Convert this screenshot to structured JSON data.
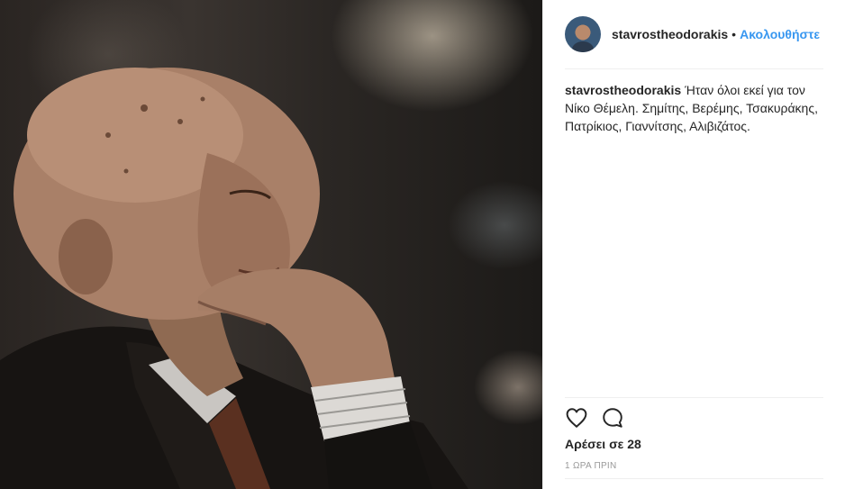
{
  "post": {
    "username": "stavrostheodorakis",
    "separator": "•",
    "follow_label": "Ακολουθήστε",
    "caption_user": "stavrostheodorakis",
    "caption_text": "Ήταν όλοι εκεί για τον Νίκο Θέμελη. Σημίτης, Βερέμης, Τσακυράκης, Πατρίκιος, Γιαννίτσης, Αλιβιζάτος.",
    "likes_text": "Αρέσει σε 28",
    "timestamp": "1 ΩΡΑ ΠΡΙΝ"
  },
  "icons": {
    "like": "heart-icon",
    "comment": "comment-bubble-icon"
  },
  "colors": {
    "link": "#3897f0",
    "text": "#262626",
    "muted": "#999999",
    "divider": "#efefef"
  }
}
